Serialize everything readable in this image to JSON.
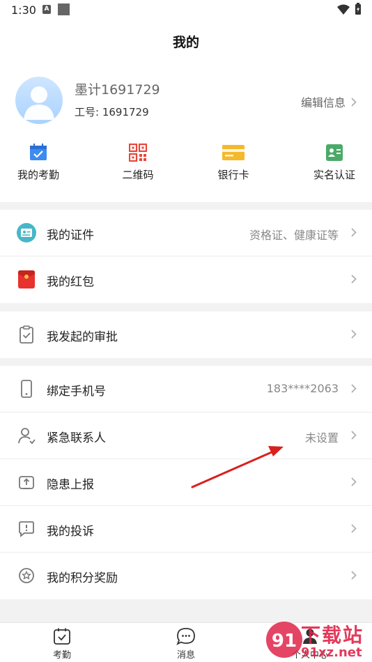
{
  "status": {
    "time": "1:30",
    "a_icon": "A"
  },
  "header": {
    "title": "我的"
  },
  "profile": {
    "name": "墨计1691729",
    "employee_id": "工号: 1691729",
    "edit_label": "编辑信息"
  },
  "quick_actions": [
    {
      "label": "我的考勤",
      "icon": "calendar-check-icon",
      "color": "#3d8bf0"
    },
    {
      "label": "二维码",
      "icon": "qr-code-icon",
      "color": "#e8463a"
    },
    {
      "label": "银行卡",
      "icon": "bank-card-icon",
      "color": "#f5b92c"
    },
    {
      "label": "实名认证",
      "icon": "id-card-icon",
      "color": "#4caa69"
    }
  ],
  "menu": {
    "certificates": {
      "label": "我的证件",
      "value": "资格证、健康证等"
    },
    "red_packet": {
      "label": "我的红包",
      "value": ""
    },
    "approvals": {
      "label": "我发起的审批",
      "value": ""
    },
    "phone": {
      "label": "绑定手机号",
      "value": "183****2063"
    },
    "emergency": {
      "label": "紧急联系人",
      "value": "未设置"
    },
    "hazard": {
      "label": "隐患上报",
      "value": ""
    },
    "complaint": {
      "label": "我的投诉",
      "value": ""
    },
    "points": {
      "label": "我的积分奖励",
      "value": ""
    }
  },
  "tabs": [
    {
      "label": "考勤",
      "icon": "attendance-icon"
    },
    {
      "label": "消息",
      "icon": "message-icon"
    },
    {
      "label": "个人中心",
      "icon": "person-icon"
    }
  ],
  "watermark": {
    "text": "下载站",
    "url": "91xz.net",
    "logo": "91"
  },
  "colors": {
    "accent": "#3d8bf0",
    "arrow": "#d8201e"
  }
}
